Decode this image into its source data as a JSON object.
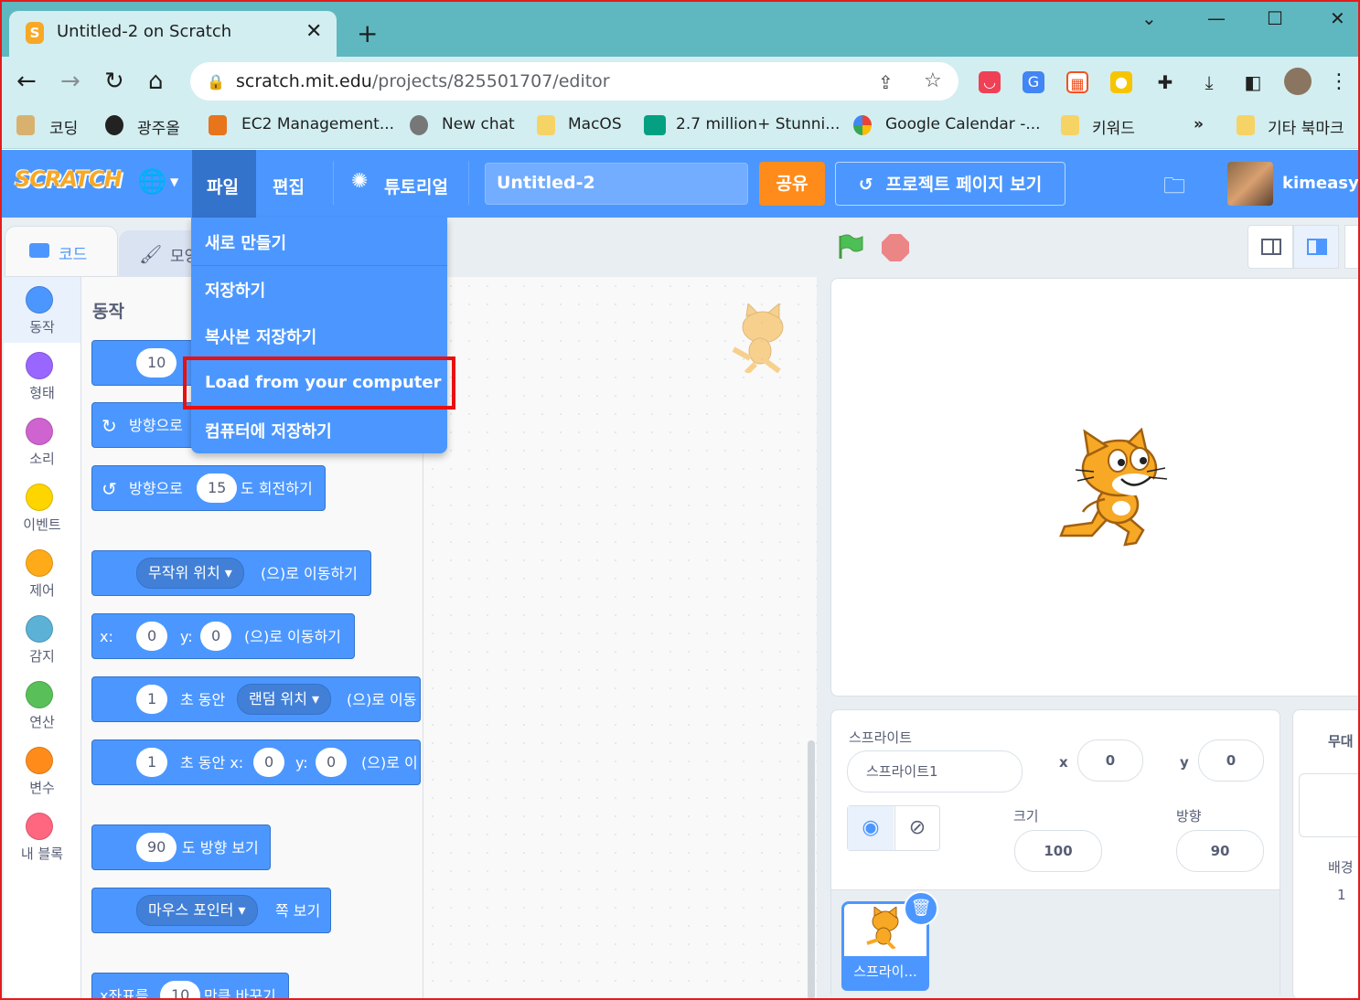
{
  "browser": {
    "tab_title": "Untitled-2 on Scratch",
    "tab_close": "✕",
    "new_tab": "+",
    "url_host": "scratch.mit.edu",
    "url_path": "/projects/825501707/editor",
    "bookmarks": [
      "코딩",
      "광주올",
      "EC2 Management...",
      "New chat",
      "MacOS",
      "2.7 million+ Stunni...",
      "Google Calendar -...",
      "키워드",
      "»",
      "기타 북마크"
    ]
  },
  "menubar": {
    "logo": "SCRATCH",
    "file": "파일",
    "edit": "편집",
    "tutorials": "튜토리얼",
    "project_title": "Untitled-2",
    "share": "공유",
    "see_project_page": "프로젝트 페이지 보기",
    "username": "kimeasyfl"
  },
  "file_menu": {
    "items": [
      "새로 만들기",
      "저장하기",
      "복사본 저장하기",
      "Load from your computer",
      "컴퓨터에 저장하기"
    ]
  },
  "editor_tabs": {
    "code": "코드",
    "costumes": "모양"
  },
  "categories": [
    {
      "label": "동작",
      "color": "#4c97ff"
    },
    {
      "label": "형태",
      "color": "#9966ff"
    },
    {
      "label": "소리",
      "color": "#cf63cf"
    },
    {
      "label": "이벤트",
      "color": "#ffd500"
    },
    {
      "label": "제어",
      "color": "#ffab19"
    },
    {
      "label": "감지",
      "color": "#5cb1d6"
    },
    {
      "label": "연산",
      "color": "#59c059"
    },
    {
      "label": "변수",
      "color": "#ff8c1a"
    },
    {
      "label": "내 블록",
      "color": "#ff6680"
    }
  ],
  "palette": {
    "heading": "동작",
    "b1": {
      "val": "10"
    },
    "b2": {
      "text": "방향으로"
    },
    "b3": {
      "pre": "방향으로",
      "val": "15",
      "post": "도 회전하기"
    },
    "b4": {
      "dd": "무작위 위치",
      "post": "(으)로 이동하기"
    },
    "b5": {
      "x": "x:",
      "xv": "0",
      "y": "y:",
      "yv": "0",
      "post": "(으)로 이동하기"
    },
    "b6": {
      "v": "1",
      "t": "초 동안",
      "dd": "랜덤 위치",
      "post": "(으)로 이동"
    },
    "b7": {
      "v": "1",
      "t": "초 동안 x:",
      "xv": "0",
      "y": "y:",
      "yv": "0",
      "post": "(으)로 이"
    },
    "b8": {
      "v": "90",
      "post": "도 방향 보기"
    },
    "b9": {
      "dd": "마우스 포인터",
      "post": "쪽 보기"
    },
    "b10": {
      "pre": "x좌표를",
      "v": "10",
      "post": "만큼 바꾸기"
    }
  },
  "sprite_info": {
    "sprite_label": "스프라이트",
    "sprite_name": "스프라이트1",
    "x_label": "x",
    "x": "0",
    "y_label": "y",
    "y": "0",
    "size_label": "크기",
    "size": "100",
    "direction_label": "방향",
    "direction": "90",
    "thumb_label": "스프라이..."
  },
  "stage_panel": {
    "title": "무대",
    "backdrops_label": "배경",
    "backdrops_count": "1"
  },
  "colors": {
    "scratch_blue": "#4c97ff",
    "share_orange": "#ff8c1a",
    "highlight_red": "#e81010"
  }
}
